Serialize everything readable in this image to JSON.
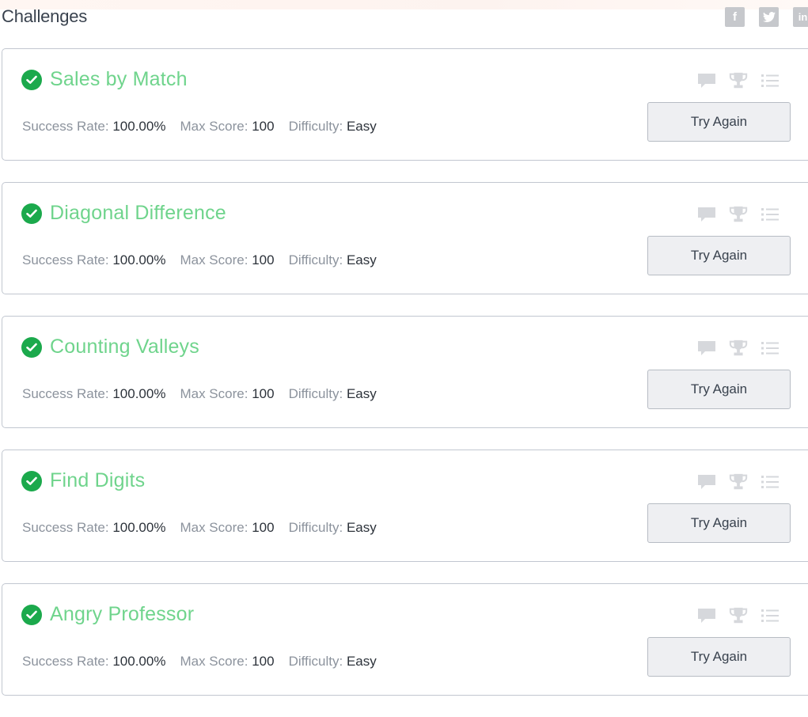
{
  "page": {
    "title": "Challenges"
  },
  "social": [
    {
      "name": "facebook-icon",
      "glyph": "f"
    },
    {
      "name": "twitter-icon",
      "glyph": "t"
    },
    {
      "name": "linkedin-icon",
      "glyph": "in"
    }
  ],
  "labels": {
    "success_rate": "Success Rate:",
    "max_score": "Max Score:",
    "difficulty": "Difficulty:",
    "button": "Try Again"
  },
  "challenges": [
    {
      "title": "Sales by Match",
      "success_rate": "100.00%",
      "max_score": "100",
      "difficulty": "Easy"
    },
    {
      "title": "Diagonal Difference",
      "success_rate": "100.00%",
      "max_score": "100",
      "difficulty": "Easy"
    },
    {
      "title": "Counting Valleys",
      "success_rate": "100.00%",
      "max_score": "100",
      "difficulty": "Easy"
    },
    {
      "title": "Find Digits",
      "success_rate": "100.00%",
      "max_score": "100",
      "difficulty": "Easy"
    },
    {
      "title": "Angry Professor",
      "success_rate": "100.00%",
      "max_score": "100",
      "difficulty": "Easy"
    }
  ],
  "colors": {
    "title_green": "#6fd48c",
    "check_green": "#1ba94c",
    "muted_icon": "#d6d8dc"
  }
}
